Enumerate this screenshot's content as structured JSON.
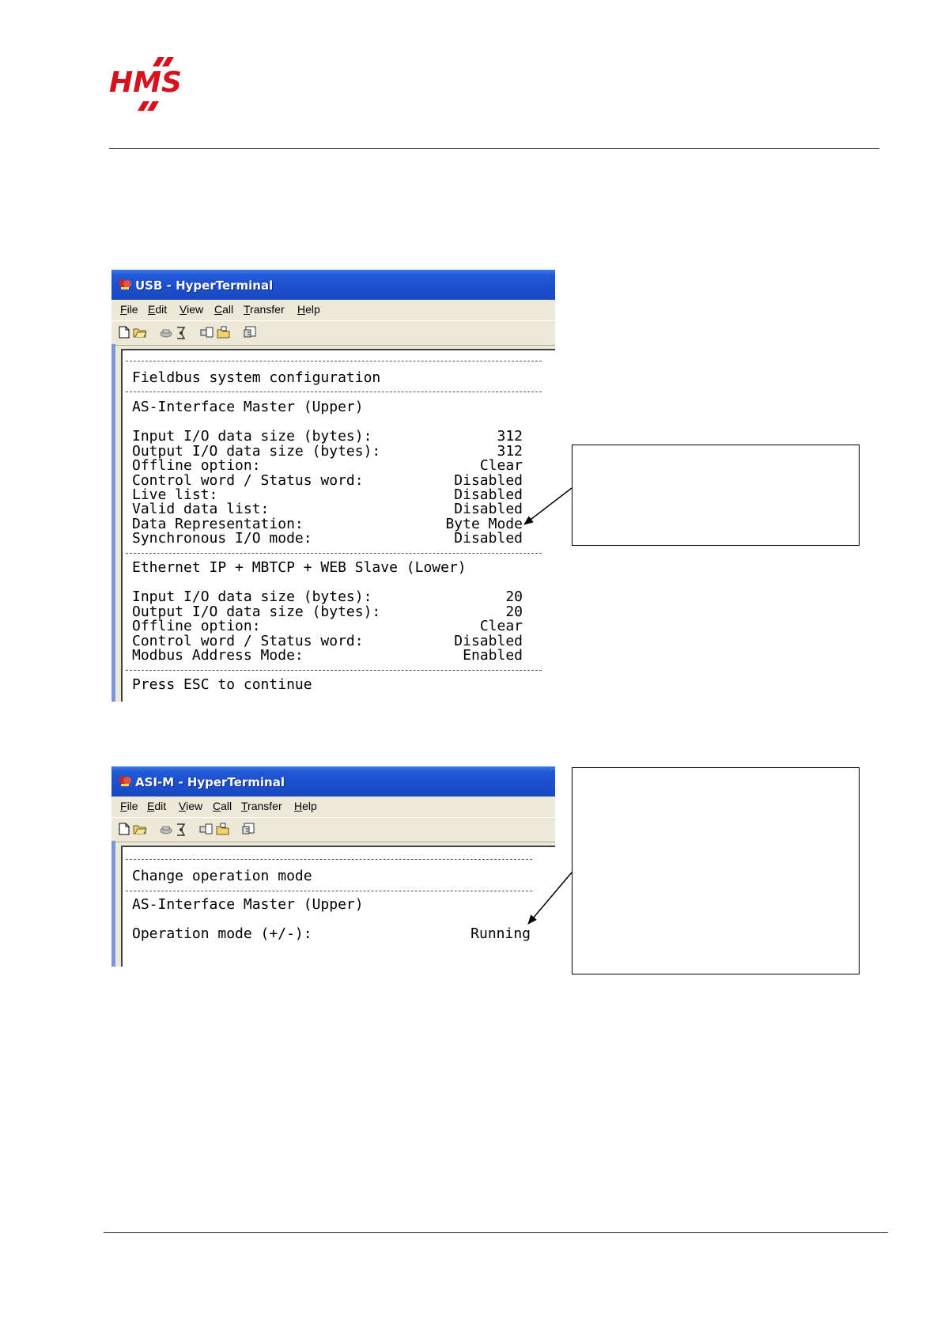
{
  "window1": {
    "title": "USB - HyperTerminal",
    "menu": [
      {
        "acc": "F",
        "rest": "ile"
      },
      {
        "acc": "E",
        "rest": "dit"
      },
      {
        "acc": "V",
        "rest": "iew"
      },
      {
        "acc": "C",
        "rest": "all"
      },
      {
        "acc": "T",
        "rest": "ransfer"
      },
      {
        "acc": "H",
        "rest": "elp"
      }
    ],
    "heading": "Fieldbus system configuration",
    "upper_title": "AS-Interface Master (Upper)",
    "upper_rows": [
      {
        "label": "Input I/O data size (bytes):",
        "value": "312"
      },
      {
        "label": "Output I/O data size (bytes):",
        "value": "312"
      },
      {
        "label": "Offline option:",
        "value": "Clear"
      },
      {
        "label": "Control word / Status word:",
        "value": "Disabled"
      },
      {
        "label": "Live list:",
        "value": "Disabled"
      },
      {
        "label": "Valid data list:",
        "value": "Disabled"
      },
      {
        "label": "Data Representation:",
        "value": "Byte Mode"
      },
      {
        "label": "Synchronous I/O mode:",
        "value": "Disabled"
      }
    ],
    "lower_title": "Ethernet IP + MBTCP + WEB Slave (Lower)",
    "lower_rows": [
      {
        "label": "Input I/O data size (bytes):",
        "value": "20"
      },
      {
        "label": "Output I/O data size (bytes):",
        "value": "20"
      },
      {
        "label": "Offline option:",
        "value": "Clear"
      },
      {
        "label": "Control word / Status word:",
        "value": "Disabled"
      },
      {
        "label": "Modbus Address Mode:",
        "value": "Enabled"
      }
    ],
    "footer": "Press ESC to continue"
  },
  "window2": {
    "title": "ASI-M - HyperTerminal",
    "menu": [
      {
        "acc": "F",
        "rest": "ile"
      },
      {
        "acc": "E",
        "rest": "dit"
      },
      {
        "acc": "V",
        "rest": "iew"
      },
      {
        "acc": "C",
        "rest": "all"
      },
      {
        "acc": "T",
        "rest": "ransfer"
      },
      {
        "acc": "H",
        "rest": "elp"
      }
    ],
    "heading": "Change operation mode",
    "upper_title": "AS-Interface Master (Upper)",
    "row": {
      "label": "Operation mode (+/-):",
      "value": "Running"
    }
  }
}
